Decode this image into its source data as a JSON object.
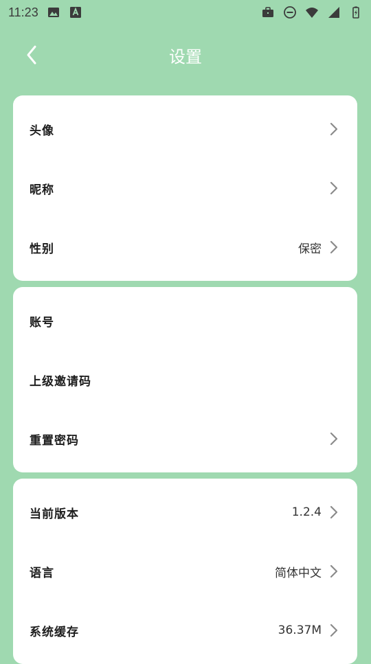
{
  "status_bar": {
    "time": "11:23",
    "left_icons": [
      "image-icon",
      "text-a-icon"
    ],
    "right_icons": [
      "briefcase-icon",
      "dnd-icon",
      "wifi-icon",
      "signal-icon",
      "battery-icon"
    ]
  },
  "header": {
    "title": "设置",
    "back_icon": "chevron-left-icon"
  },
  "groups": [
    {
      "items": [
        {
          "label": "头像",
          "value": "",
          "has_chevron": true
        },
        {
          "label": "昵称",
          "value": "",
          "has_chevron": true
        },
        {
          "label": "性别",
          "value": "保密",
          "has_chevron": true
        }
      ]
    },
    {
      "items": [
        {
          "label": "账号",
          "value": "",
          "has_chevron": false
        },
        {
          "label": "上级邀请码",
          "value": "",
          "has_chevron": false
        },
        {
          "label": "重置密码",
          "value": "",
          "has_chevron": true
        }
      ]
    },
    {
      "items": [
        {
          "label": "当前版本",
          "value": "1.2.4",
          "has_chevron": true
        },
        {
          "label": "语言",
          "value": "简体中文",
          "has_chevron": true
        },
        {
          "label": "系统缓存",
          "value": "36.37M",
          "has_chevron": true
        }
      ]
    }
  ],
  "colors": {
    "background": "#9fd9b0",
    "card": "#ffffff",
    "title": "#ffffff",
    "chevron": "#8a8a8a"
  }
}
